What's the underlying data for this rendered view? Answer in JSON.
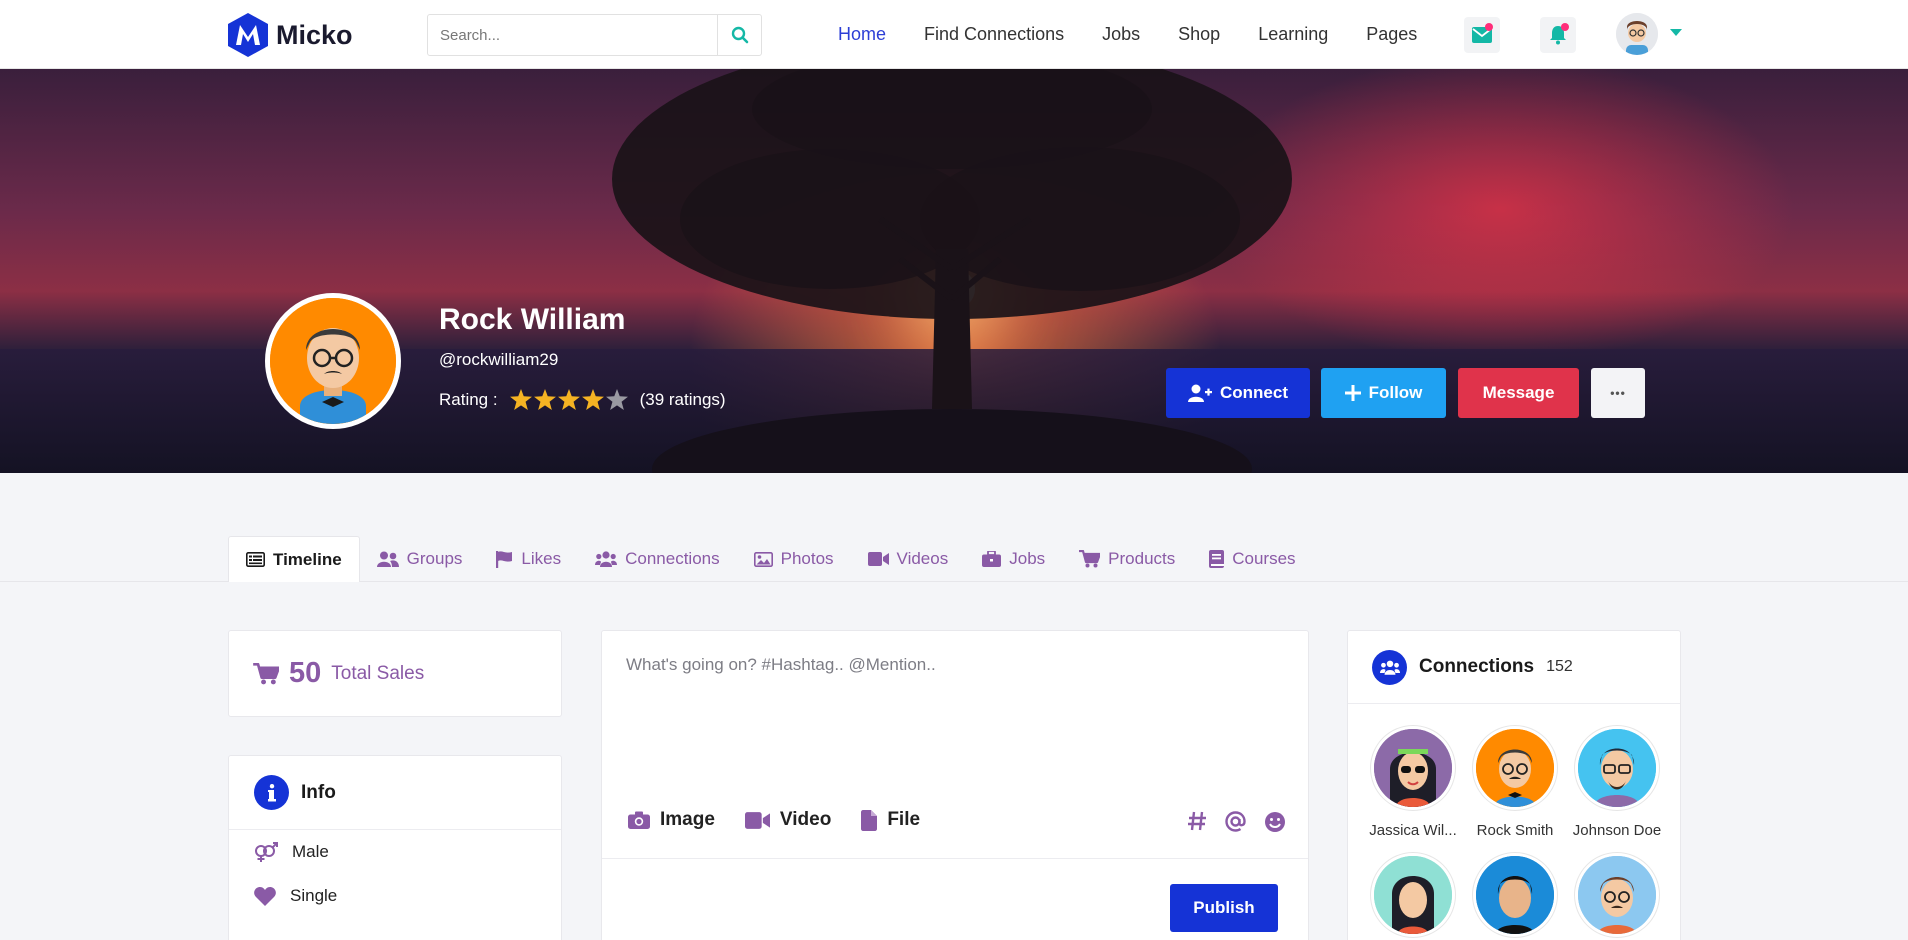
{
  "brand": {
    "name": "Micko",
    "accent": "#1533d6",
    "tab_color": "#8a5aa6"
  },
  "search": {
    "placeholder": "Search..."
  },
  "nav": {
    "items": [
      {
        "label": "Home",
        "active": true
      },
      {
        "label": "Find Connections"
      },
      {
        "label": "Jobs"
      },
      {
        "label": "Shop"
      },
      {
        "label": "Learning"
      },
      {
        "label": "Pages"
      }
    ]
  },
  "profile": {
    "name": "Rock William",
    "handle": "@rockwilliam29",
    "rating_label": "Rating :",
    "rating_value": 4,
    "rating_max": 5,
    "rating_count": "(39 ratings)"
  },
  "actions": {
    "connect": "Connect",
    "follow": "Follow",
    "message": "Message",
    "more": "•••"
  },
  "tabs": [
    {
      "label": "Timeline",
      "icon": "timeline-icon",
      "active": true
    },
    {
      "label": "Groups",
      "icon": "groups-icon"
    },
    {
      "label": "Likes",
      "icon": "flag-icon"
    },
    {
      "label": "Connections",
      "icon": "users-icon"
    },
    {
      "label": "Photos",
      "icon": "image-icon"
    },
    {
      "label": "Videos",
      "icon": "video-icon"
    },
    {
      "label": "Jobs",
      "icon": "briefcase-icon"
    },
    {
      "label": "Products",
      "icon": "cart-icon"
    },
    {
      "label": "Courses",
      "icon": "book-icon"
    }
  ],
  "sales": {
    "value": "50",
    "label": "Total Sales"
  },
  "info": {
    "title": "Info",
    "rows": [
      {
        "label": "Male",
        "icon": "gender-icon"
      },
      {
        "label": "Single",
        "icon": "heart-icon"
      }
    ]
  },
  "composer": {
    "placeholder": "What's going on? #Hashtag.. @Mention..",
    "tools": {
      "image": "Image",
      "video": "Video",
      "file": "File"
    },
    "publish": "Publish"
  },
  "connections": {
    "title": "Connections",
    "count": "152",
    "people": [
      {
        "name": "Jassica Wil...",
        "bg": "#8c6aa8"
      },
      {
        "name": "Rock Smith",
        "bg": "#ff8a00"
      },
      {
        "name": "Johnson Doe",
        "bg": "#45c3f0"
      },
      {
        "name": "",
        "bg": "#8fe0d4"
      },
      {
        "name": "",
        "bg": "#1b8bd8"
      },
      {
        "name": "",
        "bg": "#8cc8f0"
      }
    ]
  }
}
